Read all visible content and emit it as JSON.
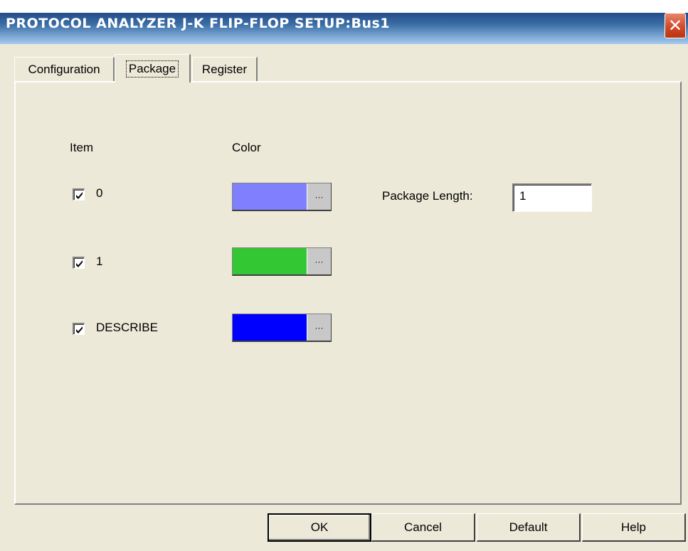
{
  "window": {
    "title": "PROTOCOL ANALYZER J-K FLIP-FLOP SETUP:Bus1",
    "close_glyph": "✕"
  },
  "tabs": [
    {
      "label": "Configuration",
      "active": false
    },
    {
      "label": "Package",
      "active": true
    },
    {
      "label": "Register",
      "active": false
    }
  ],
  "panel": {
    "item_header": "Item",
    "color_header": "Color",
    "items": [
      {
        "label": "0",
        "checked": true,
        "color": "#8080ff"
      },
      {
        "label": "1",
        "checked": true,
        "color": "#33c833"
      },
      {
        "label": "DESCRIBE",
        "checked": true,
        "color": "#0000ff"
      }
    ],
    "ellipsis": "···",
    "package_length_label": "Package Length:",
    "package_length_value": "1"
  },
  "buttons": {
    "ok": "OK",
    "cancel": "Cancel",
    "default": "Default",
    "help": "Help"
  },
  "icons": {
    "close": "close-icon",
    "checkmark": "checkmark-icon",
    "ellipsis": "ellipsis-icon"
  }
}
